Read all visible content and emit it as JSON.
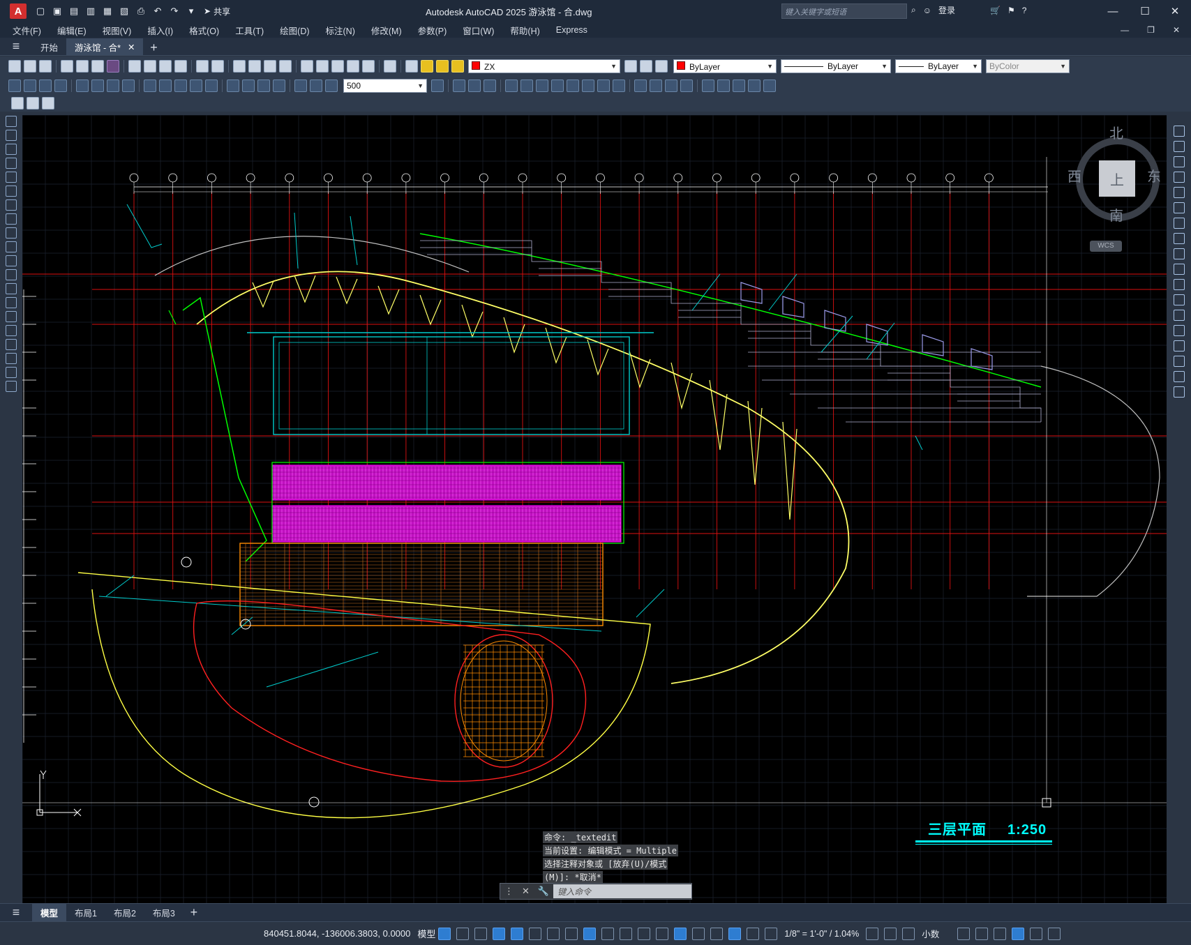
{
  "app": {
    "logo_letter": "A",
    "title": "Autodesk AutoCAD 2025    游泳馆 - 合.dwg",
    "share_label": "共享",
    "search_placeholder": "键入关键字或短语",
    "login_label": "登录"
  },
  "menu": [
    "文件(F)",
    "编辑(E)",
    "视图(V)",
    "插入(I)",
    "格式(O)",
    "工具(T)",
    "绘图(D)",
    "标注(N)",
    "修改(M)",
    "参数(P)",
    "窗口(W)",
    "帮助(H)",
    "Express"
  ],
  "tabs": [
    {
      "label": "开始",
      "active": false
    },
    {
      "label": "游泳馆 - 合*",
      "active": true
    }
  ],
  "layer_toolbar": {
    "layer_name": "ZX",
    "color": "ByLayer",
    "linetype": "ByLayer",
    "lineweight": "ByLayer",
    "plotstyle": "ByColor",
    "dim_scale": "500"
  },
  "viewcube": {
    "north": "北",
    "south": "南",
    "east": "东",
    "west": "西",
    "top": "上",
    "wcs": "WCS"
  },
  "drawing": {
    "title": "三层平面",
    "scale": "1:250"
  },
  "command_history": [
    "命令: _textedit",
    "当前设置: 编辑模式 = Multiple",
    "选择注释对象或 [放弃(U)/模式",
    "(M)]: *取消*"
  ],
  "command_prompt": "键入命令",
  "layout_tabs": [
    {
      "label": "模型",
      "active": true
    },
    {
      "label": "布局1",
      "active": false
    },
    {
      "label": "布局2",
      "active": false
    },
    {
      "label": "布局3",
      "active": false
    }
  ],
  "status": {
    "coordinates": "840451.8044, -136006.3803, 0.0000",
    "space": "模型",
    "annotation_scale": "1/8\" = 1'-0\" / 1.04%",
    "units": "小数"
  },
  "colors": {
    "accent": "#00ffff",
    "grid_red": "#ff0000",
    "seat_magenta": "#ff00ff",
    "roof_yellow": "#ffff00",
    "wall_green": "#00ff00",
    "floor_orange": "#ff8c00"
  }
}
